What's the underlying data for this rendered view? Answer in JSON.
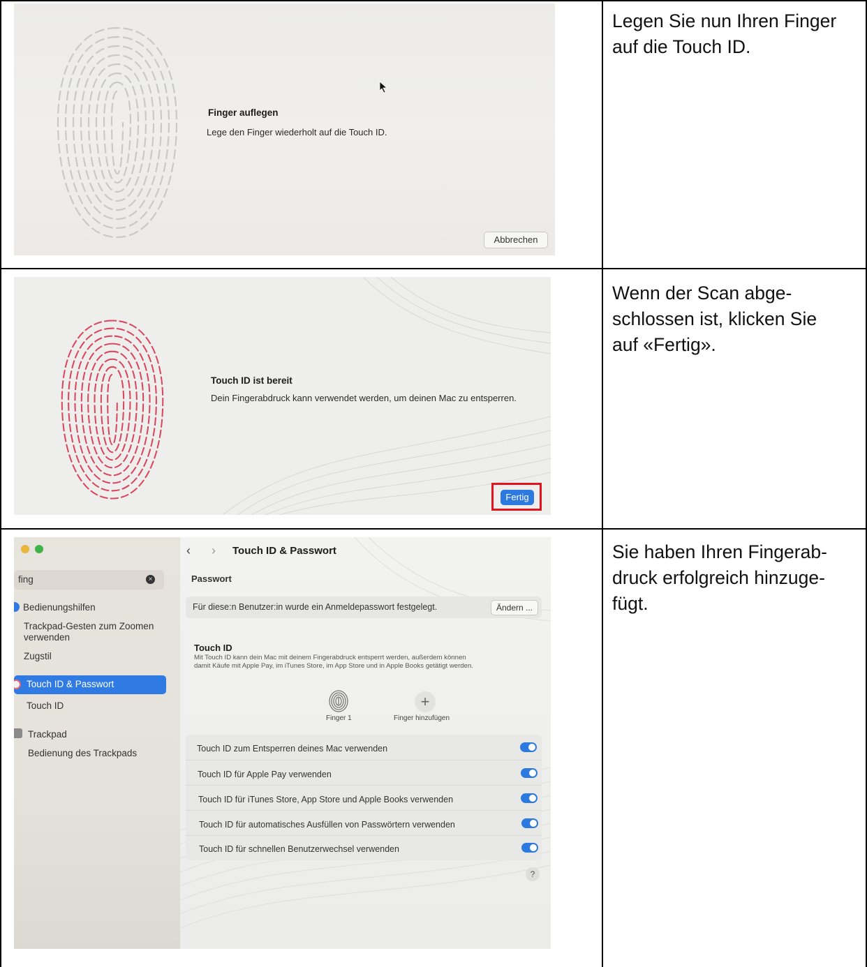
{
  "instructions": [
    "Legen Sie nun Ihren Finger auf die Touch ID.",
    "Wenn der Scan abge-schlossen ist, klicken Sie auf «Fertig».",
    "Sie haben Ihren Fingerab-druck erfolgreich hinzuge-fügt."
  ],
  "instruction_lines": {
    "row1": [
      "Legen Sie nun Ihren Finger",
      "auf die Touch ID."
    ],
    "row2": [
      "Wenn der Scan abge-",
      "schlossen ist, klicken Sie",
      "auf «Fertig»."
    ],
    "row3": [
      "Sie haben Ihren Fingerab-",
      "druck erfolgreich hinzuge-",
      "fügt."
    ]
  },
  "screen1": {
    "title": "Finger auflegen",
    "body": "Lege den Finger wiederholt auf die Touch ID.",
    "cancel_label": "Abbrechen",
    "fingerprint_color": "#c9c9c7"
  },
  "screen2": {
    "title": "Touch ID ist bereit",
    "body": "Dein Fingerabdruck kann verwendet werden, um deinen Mac zu entsperren.",
    "done_label": "Fertig",
    "fingerprint_color": "#d9475e",
    "highlight_color": "#e0141c"
  },
  "screen3": {
    "sidebar": {
      "search_value": "fing",
      "items": [
        {
          "label": "Bedienungshilfen",
          "type": "category"
        },
        {
          "label": "Trackpad-Gesten zum Zoomen verwenden",
          "type": "sub"
        },
        {
          "label": "Zugstil",
          "type": "sub"
        },
        {
          "label": "Touch ID & Passwort",
          "type": "category",
          "selected": true
        },
        {
          "label": "Touch ID",
          "type": "sub"
        },
        {
          "label": "Trackpad",
          "type": "category"
        },
        {
          "label": "Bedienung des Trackpads",
          "type": "sub"
        }
      ]
    },
    "main": {
      "title": "Touch ID & Passwort",
      "password_section": "Passwort",
      "password_text": "Für diese:n Benutzer:in wurde ein Anmeldepasswort festgelegt.",
      "change_label": "Ändern ...",
      "touchid_section": "Touch ID",
      "touchid_desc_1": "Mit Touch ID kann dein Mac mit deinem Fingerabdruck entsperrt werden, außerdem können",
      "touchid_desc_2": "damit Käufe mit Apple Pay, im iTunes Store, im App Store und in Apple Books getätigt werden.",
      "finger1_label": "Finger 1",
      "add_finger_label": "Finger hinzufügen",
      "options": [
        "Touch ID zum Entsperren deines Mac verwenden",
        "Touch ID für Apple Pay verwenden",
        "Touch ID für iTunes Store, App Store und Apple Books verwenden",
        "Touch ID für automatisches Ausfüllen von Passwörtern verwenden",
        "Touch ID für schnellen Benutzerwechsel verwenden"
      ],
      "help_label": "?"
    },
    "accent_color": "#2c7ae0"
  }
}
